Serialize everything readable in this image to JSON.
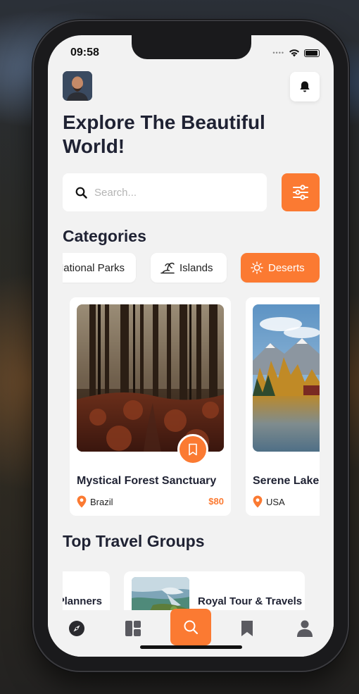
{
  "status": {
    "time": "09:58"
  },
  "header": {
    "headline": "Explore The Beautiful World!"
  },
  "search": {
    "placeholder": "Search..."
  },
  "categories": {
    "title": "Categories",
    "items": [
      {
        "label": "National Parks",
        "icon": "park-icon",
        "active": false
      },
      {
        "label": "Islands",
        "icon": "island-icon",
        "active": false
      },
      {
        "label": "Deserts",
        "icon": "sun-icon",
        "active": true
      }
    ]
  },
  "destinations": [
    {
      "title": "Mystical Forest Sanctuary",
      "location": "Brazil",
      "price": "$80"
    },
    {
      "title": "Serene Lake",
      "location": "USA",
      "price": ""
    }
  ],
  "groups": {
    "title": "Top Travel Groups",
    "items": [
      {
        "name": "Planners"
      },
      {
        "name": "Royal Tour & Travels"
      }
    ]
  },
  "tabs": [
    {
      "name": "compass-icon",
      "active": false
    },
    {
      "name": "dashboard-icon",
      "active": false
    },
    {
      "name": "search-icon",
      "active": true
    },
    {
      "name": "bookmark-icon",
      "active": false
    },
    {
      "name": "user-icon",
      "active": false
    }
  ],
  "colors": {
    "accent": "#fb7a32",
    "text": "#1f2233",
    "background": "#f2f2f2"
  }
}
